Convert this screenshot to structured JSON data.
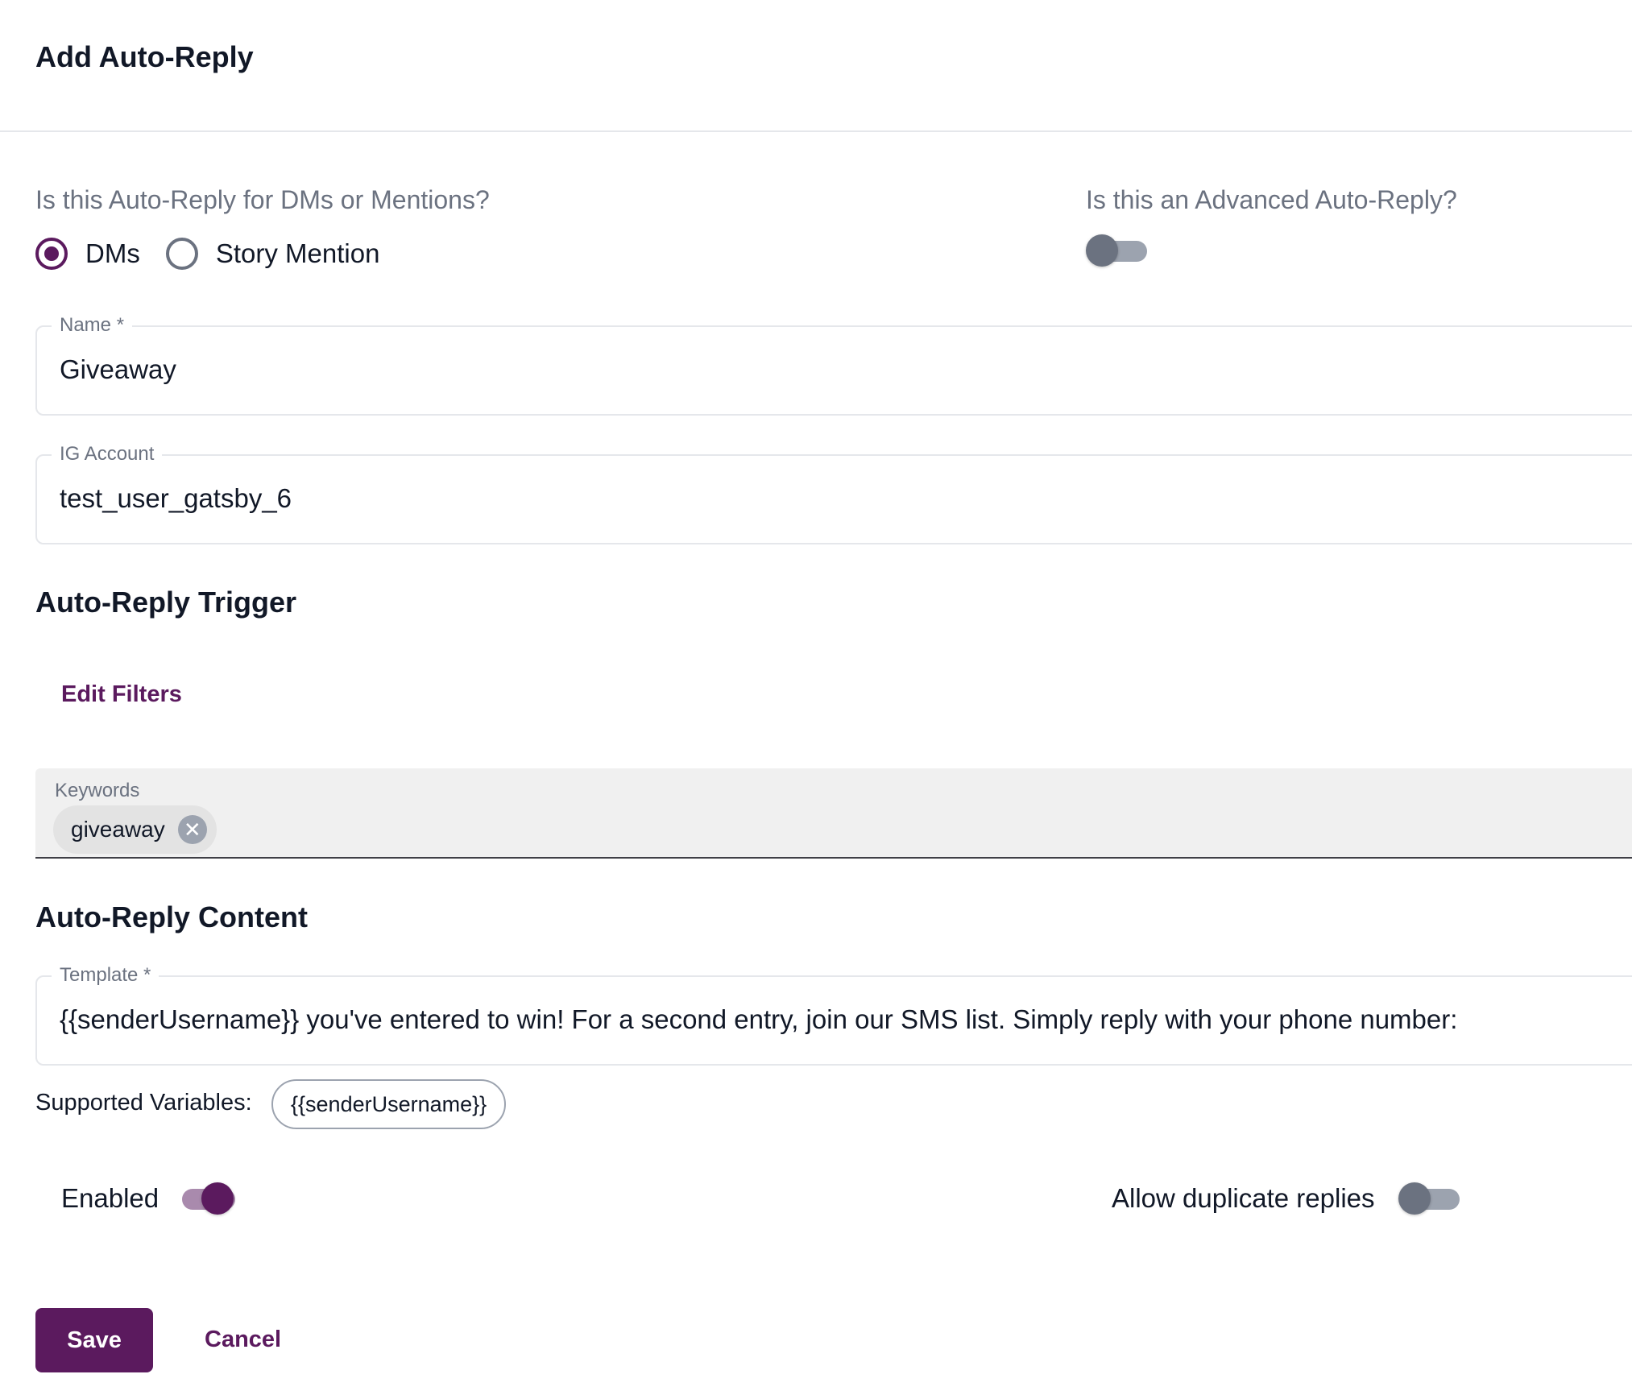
{
  "header": {
    "title": "Add Auto-Reply"
  },
  "type_question": {
    "label": "Is this Auto-Reply for DMs or Mentions?",
    "options": [
      {
        "label": "DMs",
        "selected": true
      },
      {
        "label": "Story Mention",
        "selected": false
      }
    ]
  },
  "advanced_question": {
    "label": "Is this an Advanced Auto-Reply?",
    "enabled": false
  },
  "name_field": {
    "label": "Name *",
    "value": "Giveaway"
  },
  "account_field": {
    "label": "IG Account",
    "value": "test_user_gatsby_6"
  },
  "trigger": {
    "title": "Auto-Reply Trigger",
    "edit_filters_label": "Edit Filters",
    "keywords_label": "Keywords",
    "keywords": [
      "giveaway"
    ]
  },
  "content": {
    "title": "Auto-Reply Content",
    "template_label": "Template *",
    "template_value": "{{senderUsername}} you've entered to win! For a second entry, join our SMS list. Simply reply with your phone number:",
    "variables_label": "Supported Variables:",
    "variables": [
      "{{senderUsername}}"
    ]
  },
  "toggles": {
    "enabled_label": "Enabled",
    "enabled": true,
    "duplicates_label": "Allow duplicate replies",
    "duplicates": false
  },
  "actions": {
    "save_label": "Save",
    "cancel_label": "Cancel"
  },
  "colors": {
    "accent": "#5b1a5e",
    "muted_text": "#6b7280",
    "border": "#e5e7eb"
  }
}
